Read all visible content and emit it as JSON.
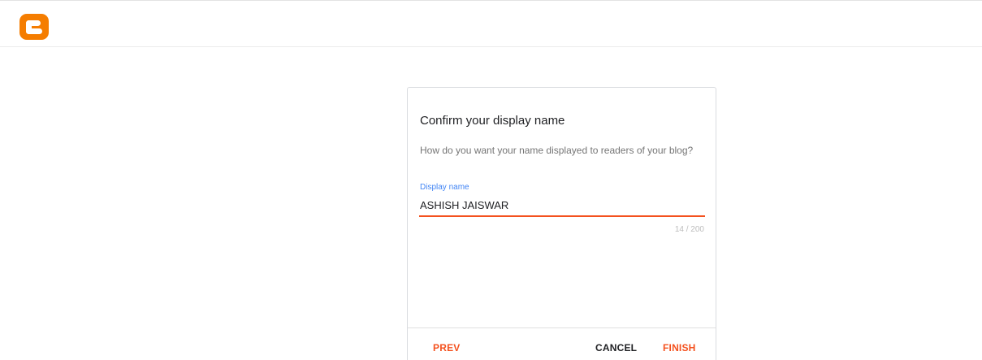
{
  "app": {
    "logo_icon": "blogger-logo-icon",
    "brand_color": "#f57d00"
  },
  "dialog": {
    "title": "Confirm your display name",
    "subtitle": "How do you want your name displayed to readers of your blog?",
    "field": {
      "label": "Display name",
      "value": "ASHISH JAISWAR",
      "counter": "14 / 200"
    },
    "buttons": {
      "prev": "PREV",
      "cancel": "CANCEL",
      "finish": "FINISH"
    }
  },
  "colors": {
    "accent": "#f4511e",
    "label_blue": "#4285f4"
  }
}
